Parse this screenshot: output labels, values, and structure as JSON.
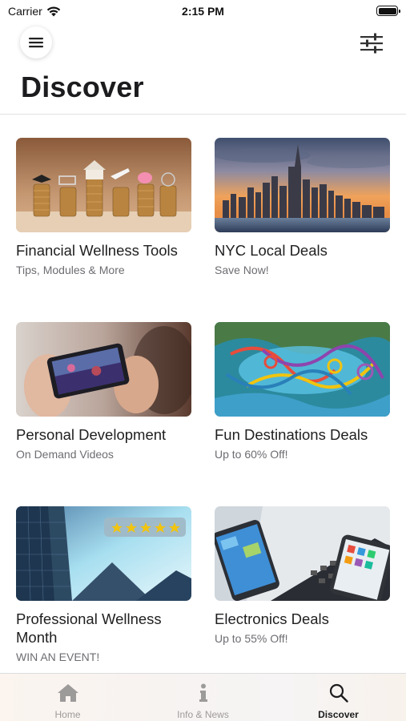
{
  "status_bar": {
    "carrier": "Carrier",
    "time": "2:15 PM"
  },
  "header": {
    "title": "Discover"
  },
  "cards": [
    {
      "title": "Financial Wellness Tools",
      "subtitle": "Tips, Modules & More"
    },
    {
      "title": "NYC Local Deals",
      "subtitle": "Save Now!"
    },
    {
      "title": "Personal Development",
      "subtitle": "On Demand Videos"
    },
    {
      "title": "Fun Destinations Deals",
      "subtitle": "Up to 60% Off!"
    },
    {
      "title": "Professional Wellness Month",
      "subtitle": "WIN AN EVENT!"
    },
    {
      "title": "Electronics Deals",
      "subtitle": "Up to 55% Off!"
    }
  ],
  "tabs": [
    {
      "label": "Home",
      "icon": "home-icon",
      "active": false
    },
    {
      "label": "Info & News",
      "icon": "info-icon",
      "active": false
    },
    {
      "label": "Discover",
      "icon": "search-icon",
      "active": true
    }
  ],
  "colors": {
    "active_tab": "#1c1c1e",
    "inactive_tab": "#9d9a9a",
    "subtitle": "#6d6d72"
  }
}
